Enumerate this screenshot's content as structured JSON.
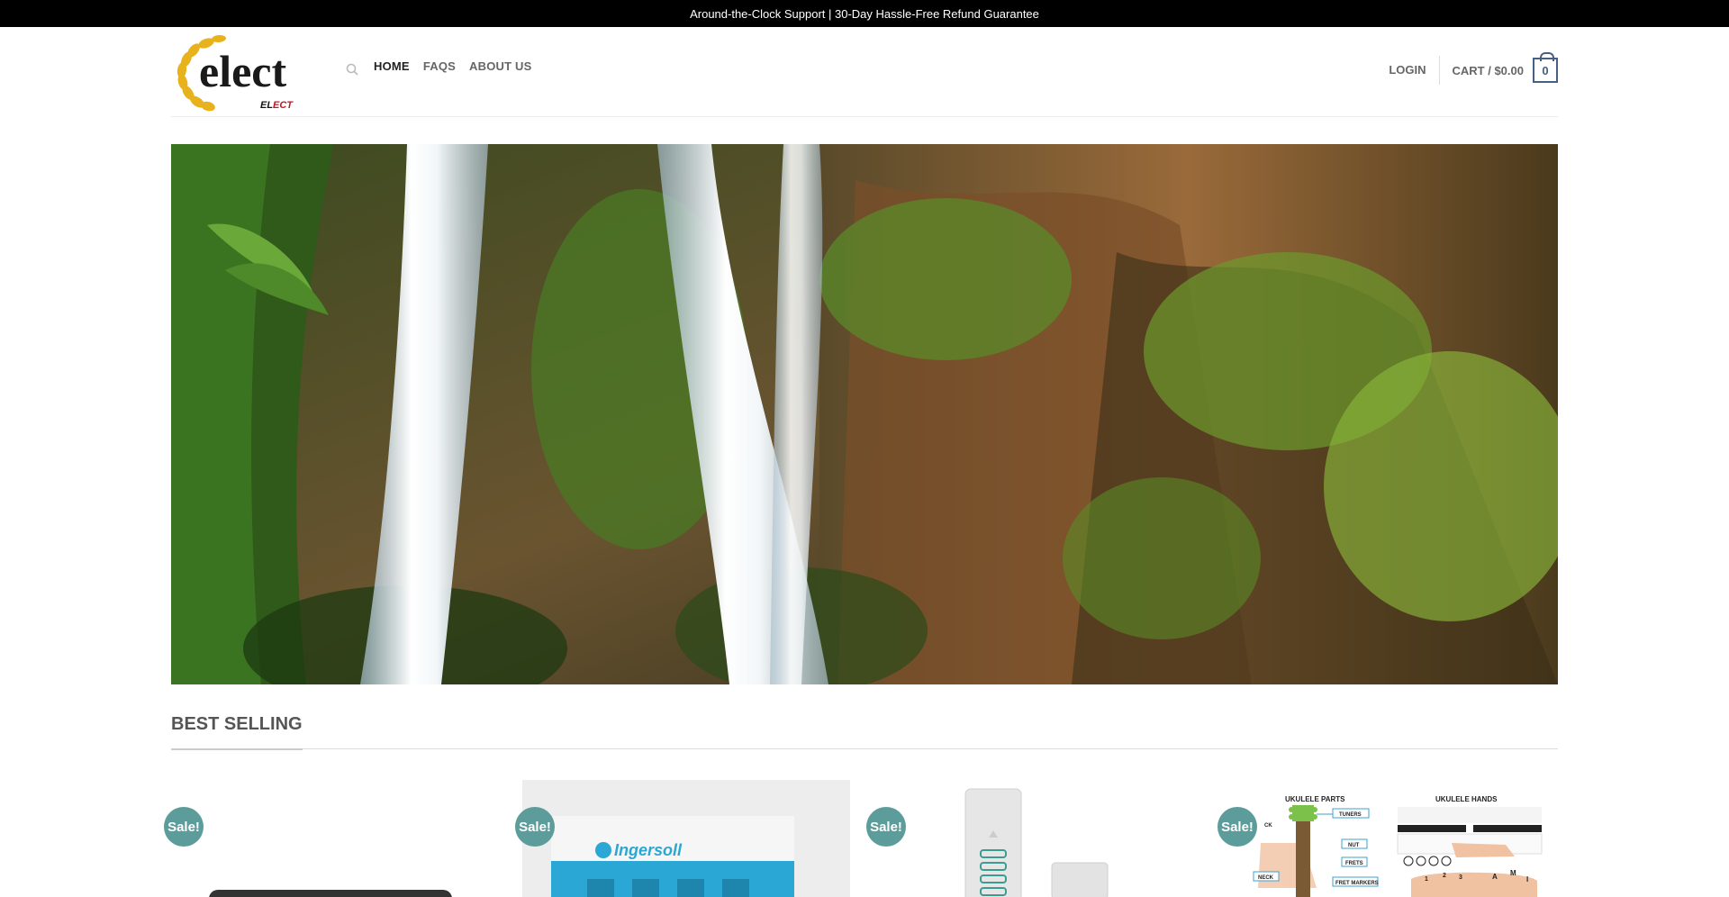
{
  "topbar": {
    "text": "Around-the-Clock Support | 30-Day Hassle-Free Refund Guarantee"
  },
  "header": {
    "logo": {
      "word": "elect",
      "sub_a": "EL",
      "sub_b": "ECT"
    },
    "nav": [
      {
        "label": "HOME",
        "active": true
      },
      {
        "label": "FAQS",
        "active": false
      },
      {
        "label": "ABOUT US",
        "active": false
      }
    ],
    "login_label": "LOGIN",
    "cart_label": "CART / $0.00",
    "cart_count": "0"
  },
  "section": {
    "title": "BEST SELLING"
  },
  "products": [
    {
      "badge": "Sale!"
    },
    {
      "badge": "Sale!",
      "brand": "Ingersoll"
    },
    {
      "badge": "Sale!"
    },
    {
      "badge": "Sale!",
      "parts_title": "UKULELE PARTS",
      "hands_title": "UKULELE HANDS",
      "labels": [
        "TUNERS",
        "NUT",
        "FRETS",
        "NECK",
        "FRET MARKERS"
      ]
    }
  ],
  "colors": {
    "accent": "#446084",
    "sale": "#5c9c9a",
    "topbar": "#000000"
  }
}
